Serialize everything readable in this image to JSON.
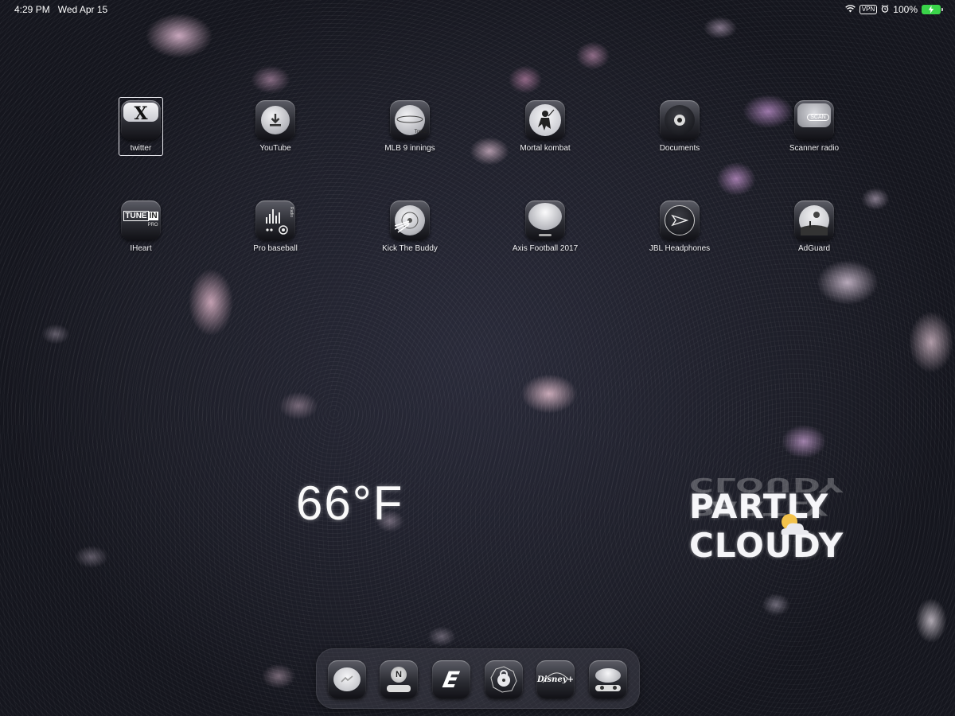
{
  "status_bar": {
    "time": "4:29 PM",
    "date": "Wed Apr 15",
    "vpn": "VPN",
    "battery_percent": "100%",
    "battery_level": 1.0,
    "charging": true,
    "icons": [
      "wifi-icon",
      "alarm-icon",
      "battery-icon"
    ]
  },
  "home_screen": {
    "row1": [
      {
        "label": "twitter",
        "icon": "x-logo-icon",
        "glyph": "X",
        "selected": true
      },
      {
        "label": "YouTube",
        "icon": "download-icon"
      },
      {
        "label": "MLB 9 innings",
        "icon": "planet-icon",
        "glyph": "Top-Z"
      },
      {
        "label": "Mortal kombat",
        "icon": "warrior-icon"
      },
      {
        "label": "Documents",
        "icon": "speaker-icon"
      },
      {
        "label": "Scanner radio",
        "icon": "pdf-scan-icon",
        "glyph": "SCAN"
      }
    ],
    "row2": [
      {
        "label": "IHeart",
        "icon": "tunein-icon",
        "glyph_top": "TUNE",
        "glyph_badge": "IN",
        "glyph_sub": "PRO"
      },
      {
        "label": "Pro baseball",
        "icon": "radio-equalizer-icon",
        "glyph": "Radio"
      },
      {
        "label": "Kick The Buddy",
        "icon": "disc-icon"
      },
      {
        "label": "Axis Football 2017",
        "icon": "sphere-icon"
      },
      {
        "label": "JBL Headphones",
        "icon": "send-arrow-icon"
      },
      {
        "label": "AdGuard",
        "icon": "moon-landscape-icon"
      }
    ]
  },
  "weather_widget": {
    "temperature": "66°F",
    "condition": "PARTLY CLOUDY",
    "icon": "partly-cloudy-icon"
  },
  "dock": {
    "apps": [
      {
        "icon": "messenger-icon"
      },
      {
        "icon": "n-radio-icon",
        "glyph": "N"
      },
      {
        "icon": "espn-e-icon",
        "glyph": "E"
      },
      {
        "icon": "lock-icon"
      },
      {
        "icon": "disney-plus-icon",
        "glyph": "Disney+"
      },
      {
        "icon": "retro-radio-icon"
      }
    ]
  }
}
